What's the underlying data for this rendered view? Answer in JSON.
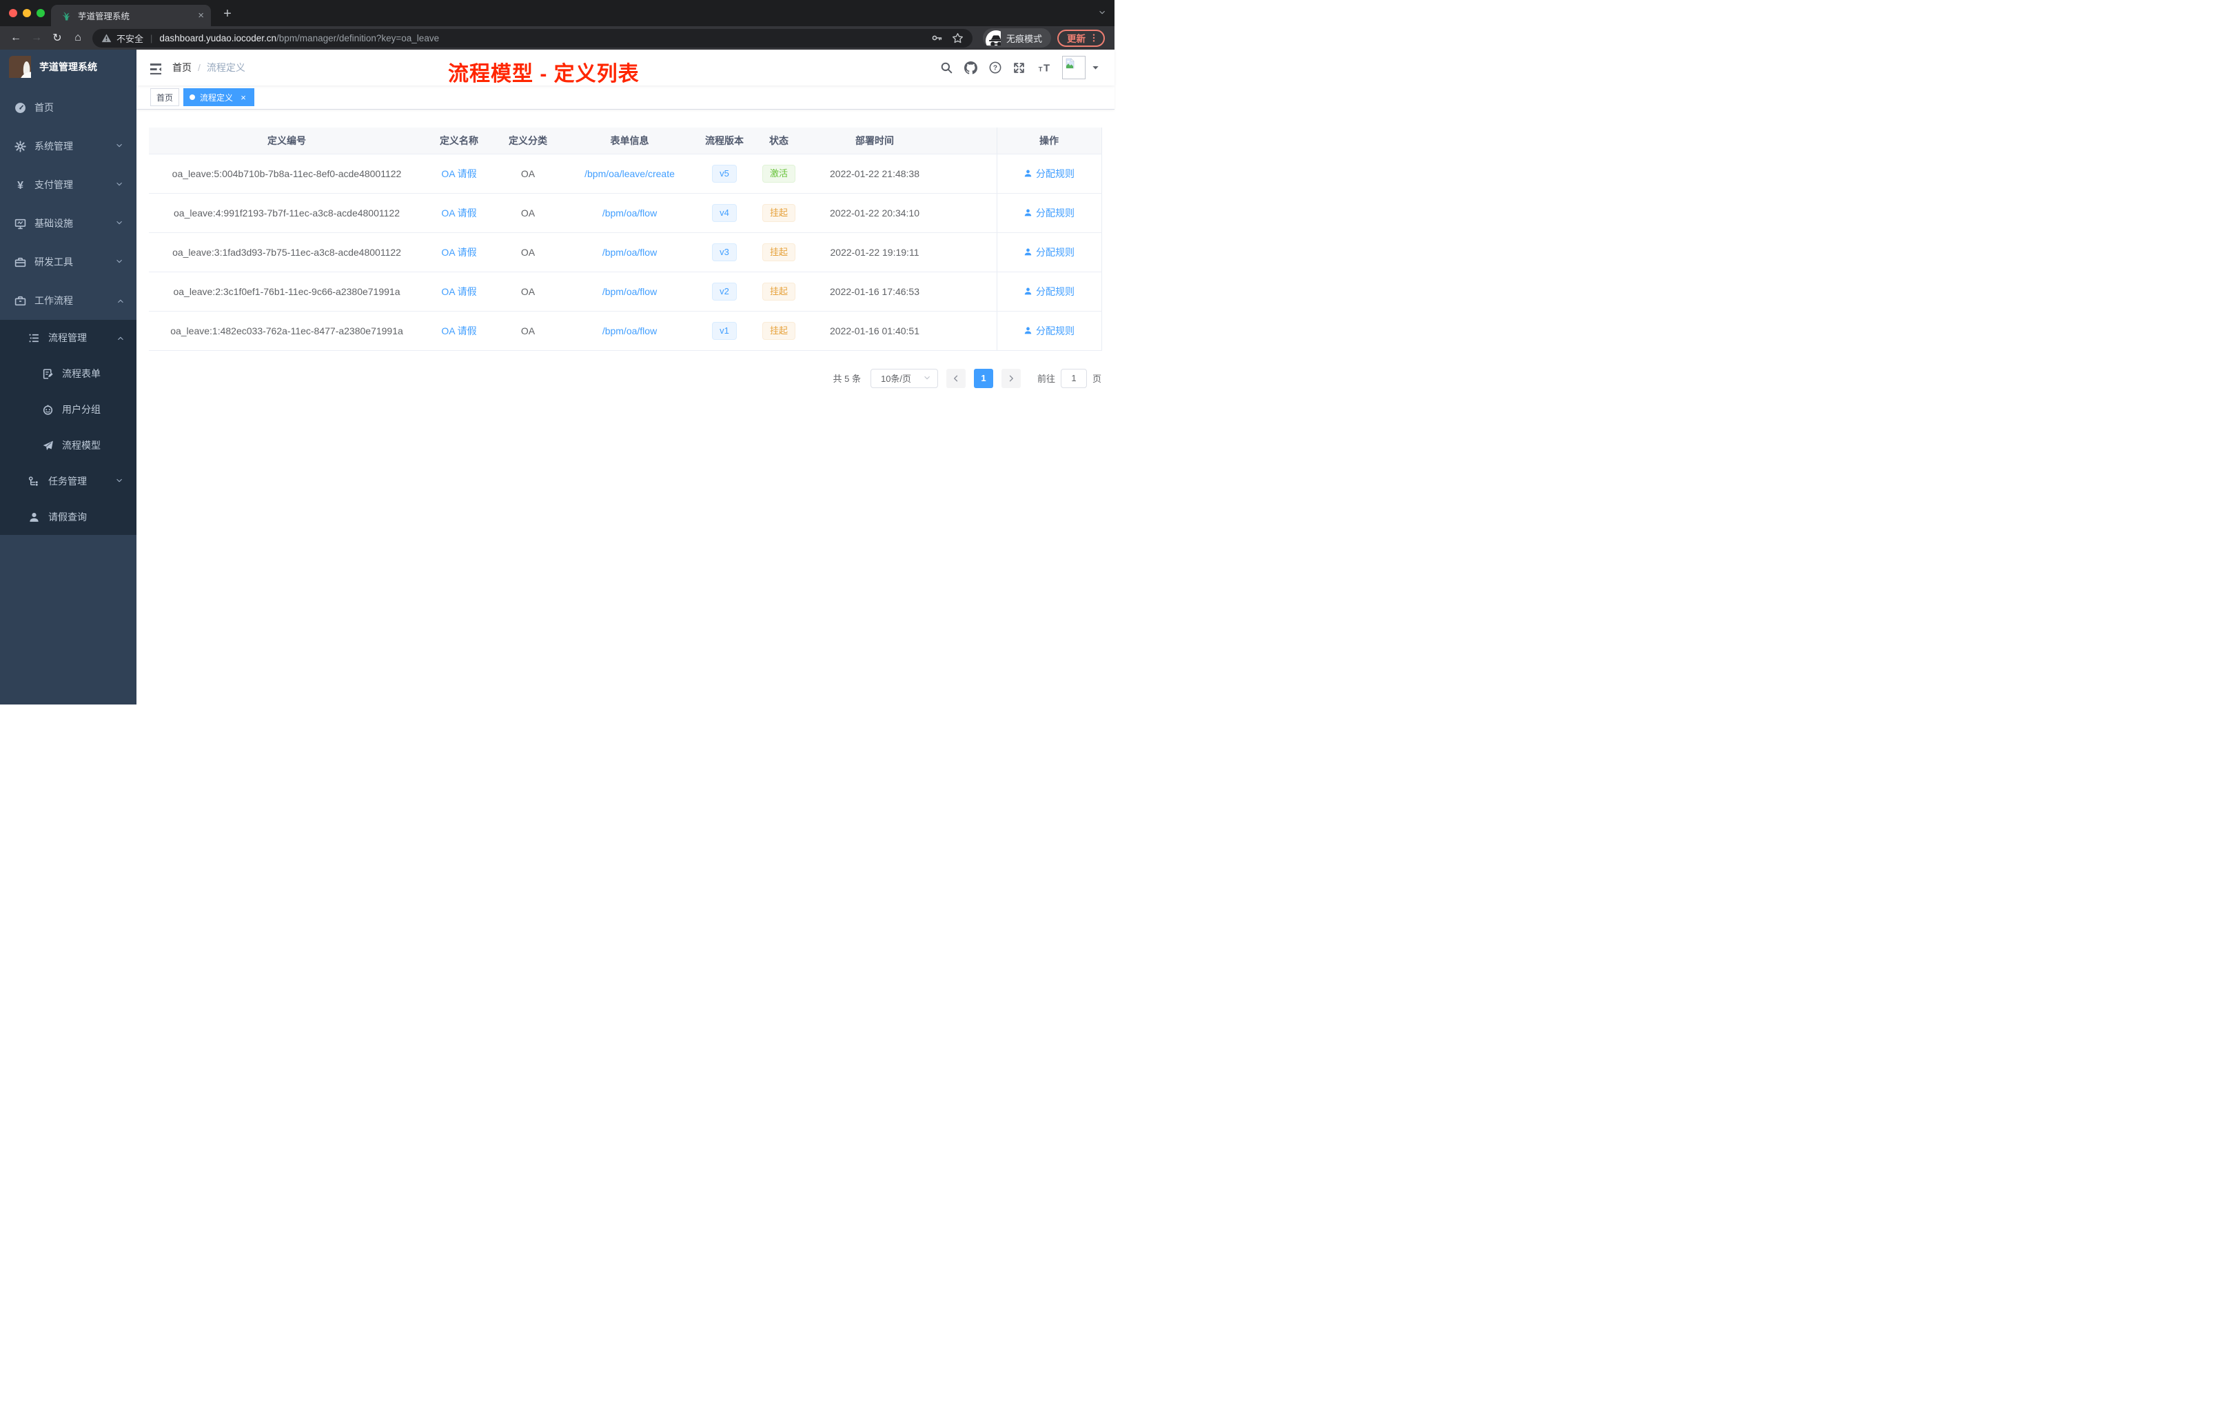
{
  "colors": {
    "accent": "#409eff",
    "sidebar_bg": "#304156",
    "submenu_bg": "#1f2d3d",
    "success": "#67c23a",
    "warning": "#e6a23c",
    "annotation_red": "#ff2600"
  },
  "browser": {
    "tab": {
      "title": "芋道管理系统",
      "favicon": "sprout-icon",
      "close_glyph": "×"
    },
    "new_tab_label": "+",
    "toolbar": {
      "back_icon": "back-arrow-icon",
      "forward_icon": "forward-arrow-icon",
      "reload_icon": "reload-icon",
      "home_icon": "home-icon",
      "security_label": "不安全",
      "separator": "|",
      "url_host": "dashboard.yudao.iocoder.cn",
      "url_path": "/bpm/manager/definition?key=oa_leave",
      "incognito_label": "无痕模式",
      "update_label": "更新"
    }
  },
  "sidebar": {
    "logo_title": "芋道管理系统",
    "items": [
      {
        "label": "首页",
        "icon": "dashboard-icon",
        "level": 0,
        "chevron": null,
        "submenu": false
      },
      {
        "label": "系统管理",
        "icon": "gear-icon",
        "level": 0,
        "chevron": "down",
        "submenu": false
      },
      {
        "label": "支付管理",
        "icon": "yuan-icon",
        "level": 0,
        "chevron": "down",
        "submenu": false
      },
      {
        "label": "基础设施",
        "icon": "monitor-icon",
        "level": 0,
        "chevron": "down",
        "submenu": false
      },
      {
        "label": "研发工具",
        "icon": "toolbox-icon",
        "level": 0,
        "chevron": "down",
        "submenu": false
      },
      {
        "label": "工作流程",
        "icon": "briefcase-icon",
        "level": 0,
        "chevron": "up",
        "submenu": false
      },
      {
        "label": "流程管理",
        "icon": "list-tree-icon",
        "level": 1,
        "chevron": "up",
        "submenu": true
      },
      {
        "label": "流程表单",
        "icon": "form-icon",
        "level": 2,
        "chevron": null,
        "submenu": true
      },
      {
        "label": "用户分组",
        "icon": "robot-icon",
        "level": 2,
        "chevron": null,
        "submenu": true
      },
      {
        "label": "流程模型",
        "icon": "send-icon",
        "level": 2,
        "chevron": null,
        "submenu": true
      },
      {
        "label": "任务管理",
        "icon": "flow-icon",
        "level": 1,
        "chevron": "down",
        "submenu": true
      },
      {
        "label": "请假查询",
        "icon": "user-icon",
        "level": 1,
        "chevron": null,
        "submenu": true
      }
    ]
  },
  "navbar": {
    "breadcrumb": {
      "home": "首页",
      "separator": "/",
      "current": "流程定义"
    },
    "right_icons": [
      "search-icon",
      "github-icon",
      "question-icon",
      "fullscreen-icon",
      "fontsize-icon"
    ]
  },
  "annotation": {
    "text": "流程模型 - 定义列表"
  },
  "tags": [
    {
      "label": "首页",
      "active": false,
      "closable": false
    },
    {
      "label": "流程定义",
      "active": true,
      "closable": true,
      "close_glyph": "×"
    }
  ],
  "table": {
    "columns": [
      {
        "key": "id",
        "label": "定义编号"
      },
      {
        "key": "name",
        "label": "定义名称"
      },
      {
        "key": "category",
        "label": "定义分类"
      },
      {
        "key": "form",
        "label": "表单信息"
      },
      {
        "key": "version",
        "label": "流程版本"
      },
      {
        "key": "status",
        "label": "状态"
      },
      {
        "key": "deploy_time",
        "label": "部署时间"
      },
      {
        "key": "filler",
        "label": ""
      },
      {
        "key": "actions",
        "label": "操作"
      }
    ],
    "rows": [
      {
        "id": "oa_leave:5:004b710b-7b8a-11ec-8ef0-acde48001122",
        "name": "OA 请假",
        "category": "OA",
        "form": "/bpm/oa/leave/create",
        "version": "v5",
        "status": {
          "label": "激活",
          "type": "success"
        },
        "deploy_time": "2022-01-22 21:48:38",
        "action": "分配规则"
      },
      {
        "id": "oa_leave:4:991f2193-7b7f-11ec-a3c8-acde48001122",
        "name": "OA 请假",
        "category": "OA",
        "form": "/bpm/oa/flow",
        "version": "v4",
        "status": {
          "label": "挂起",
          "type": "warning"
        },
        "deploy_time": "2022-01-22 20:34:10",
        "action": "分配规则"
      },
      {
        "id": "oa_leave:3:1fad3d93-7b75-11ec-a3c8-acde48001122",
        "name": "OA 请假",
        "category": "OA",
        "form": "/bpm/oa/flow",
        "version": "v3",
        "status": {
          "label": "挂起",
          "type": "warning"
        },
        "deploy_time": "2022-01-22 19:19:11",
        "action": "分配规则"
      },
      {
        "id": "oa_leave:2:3c1f0ef1-76b1-11ec-9c66-a2380e71991a",
        "name": "OA 请假",
        "category": "OA",
        "form": "/bpm/oa/flow",
        "version": "v2",
        "status": {
          "label": "挂起",
          "type": "warning"
        },
        "deploy_time": "2022-01-16 17:46:53",
        "action": "分配规则"
      },
      {
        "id": "oa_leave:1:482ec033-762a-11ec-8477-a2380e71991a",
        "name": "OA 请假",
        "category": "OA",
        "form": "/bpm/oa/flow",
        "version": "v1",
        "status": {
          "label": "挂起",
          "type": "warning"
        },
        "deploy_time": "2022-01-16 01:40:51",
        "action": "分配规则"
      }
    ]
  },
  "pagination": {
    "total_label": "共 5 条",
    "page_size_label": "10条/页",
    "current_page": "1",
    "goto_label": "前往",
    "goto_value": "1",
    "unit_label": "页"
  }
}
